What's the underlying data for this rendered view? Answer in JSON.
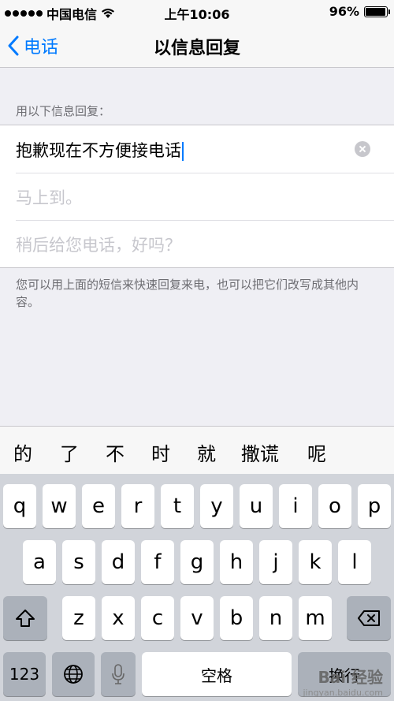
{
  "status_bar": {
    "carrier": "中国电信",
    "time": "上午10:06",
    "battery": "96%",
    "battery_level": 0.96
  },
  "nav": {
    "back_label": "电话",
    "title": "以信息回复"
  },
  "section_header": "用以下信息回复：",
  "replies": [
    {
      "text": "抱歉现在不方便接电话",
      "is_placeholder": false
    },
    {
      "text": "马上到。",
      "is_placeholder": true
    },
    {
      "text": "稍后给您电话，好吗？",
      "is_placeholder": true
    }
  ],
  "footer_note": "您可以用上面的短信来快速回复来电，也可以把它们改写成其他内容。",
  "candidates": [
    "的",
    "了",
    "不",
    "时",
    "就",
    "撒谎",
    "呢"
  ],
  "keyboard": {
    "row1": [
      "q",
      "w",
      "e",
      "r",
      "t",
      "y",
      "u",
      "i",
      "o",
      "p"
    ],
    "row2": [
      "a",
      "s",
      "d",
      "f",
      "g",
      "h",
      "j",
      "k",
      "l"
    ],
    "row3": [
      "z",
      "x",
      "c",
      "v",
      "b",
      "n",
      "m"
    ],
    "numbers_label": "123",
    "space_label": "空格",
    "return_label": "换行",
    "icons": {
      "shift": "shift-icon",
      "delete": "delete-icon",
      "globe": "globe-icon",
      "mic": "microphone-icon"
    }
  },
  "watermark": {
    "brand": "Bai 经验",
    "url": "jingyan.baidu.com"
  },
  "colors": {
    "accent": "#007aff",
    "background": "#efeff4",
    "keyboard_bg": "#d1d4da"
  }
}
